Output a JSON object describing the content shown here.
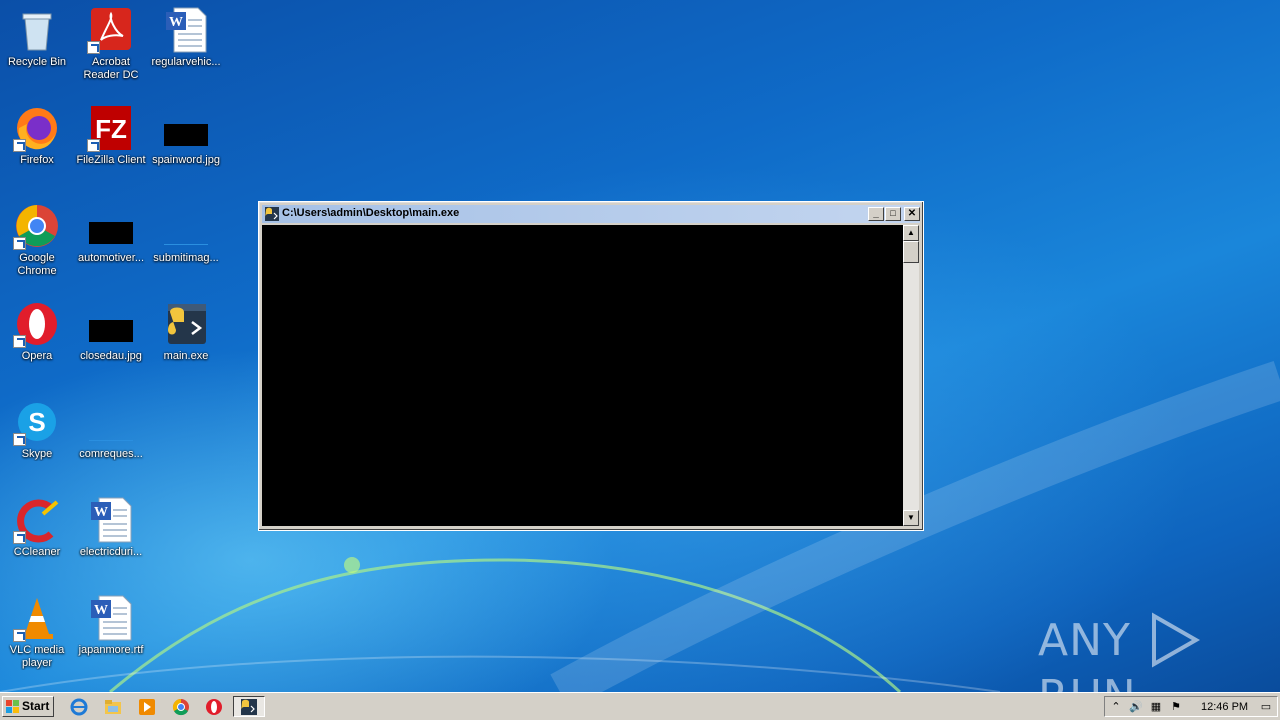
{
  "desktop": {
    "icons": [
      {
        "label": "Recycle Bin"
      },
      {
        "label": "Acrobat Reader DC"
      },
      {
        "label": "regularvehic..."
      },
      {
        "label": "Firefox"
      },
      {
        "label": "FileZilla Client"
      },
      {
        "label": "spainword.jpg"
      },
      {
        "label": "Google Chrome"
      },
      {
        "label": "automotiver..."
      },
      {
        "label": "submitimag..."
      },
      {
        "label": "Opera"
      },
      {
        "label": "closedau.jpg"
      },
      {
        "label": "main.exe"
      },
      {
        "label": "Skype"
      },
      {
        "label": "comreques..."
      },
      {
        "label": "CCleaner"
      },
      {
        "label": "electricduri..."
      },
      {
        "label": "VLC media player"
      },
      {
        "label": "japanmore.rtf"
      }
    ]
  },
  "window": {
    "title": "C:\\Users\\admin\\Desktop\\main.exe",
    "minimize": "_",
    "maximize": "□",
    "close": "✕"
  },
  "watermark": {
    "left": "ANY",
    "right": "RUN"
  },
  "taskbar": {
    "start_label": "Start",
    "clock": "12:46 PM"
  },
  "colors": {
    "console_bg": "#000000",
    "titlebar": "#a6c1e6",
    "taskbar": "#d4d0c8"
  }
}
